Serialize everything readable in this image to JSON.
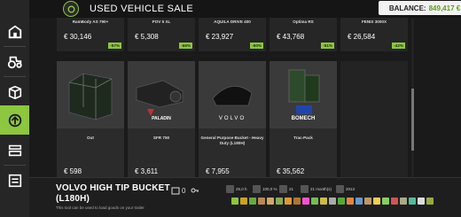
{
  "header": {
    "title": "USED VEHICLE SALE",
    "balance_label": "BALANCE:",
    "balance_value": "849,417 €"
  },
  "sidebar": {
    "items": [
      {
        "icon": "store-icon"
      },
      {
        "icon": "tractor-icon"
      },
      {
        "icon": "box-icon"
      },
      {
        "icon": "recycle-icon",
        "active": true
      },
      {
        "icon": "finance-icon"
      },
      {
        "icon": "equipment-icon"
      }
    ]
  },
  "cards_top": [
    {
      "name": "RamBody AS 790+",
      "price": "€ 30,146",
      "discount": "-57%"
    },
    {
      "name": "POV 5 XL",
      "price": "€ 5,308",
      "discount": "-66%"
    },
    {
      "name": "AQUILA DRIVE 400",
      "price": "€ 23,927",
      "discount": "-60%"
    },
    {
      "name": "Optima RS",
      "price": "€ 43,768",
      "discount": "-51%"
    },
    {
      "name": "FENIX 3000X",
      "price": "€ 26,584",
      "discount": "-42%"
    }
  ],
  "cards_row2": [
    {
      "name": "Out",
      "price": "€ 598",
      "discount": "-57%",
      "brand": ""
    },
    {
      "name": "SFR 750",
      "price": "€ 3,611",
      "discount": "-59%",
      "brand": "PALADIN"
    },
    {
      "name": "General Purpose Bucket - Heavy Duty (L180H)",
      "price": "€ 7,955",
      "discount": "-53%",
      "brand": "VOLVO"
    },
    {
      "name": "Trac-Pack",
      "price": "€ 35,562",
      "discount": "-42%",
      "brand": "BOMECH"
    }
  ],
  "selected": {
    "title": "VOLVO HIGH TIP BUCKET (L180H)",
    "description": "This tool can be used to load goods on your trailer",
    "count": "0",
    "stats": [
      "25,0 h",
      "100,0 %",
      "21",
      "21 month(s)",
      "2013"
    ]
  },
  "colors": {
    "accent": "#8dc63f",
    "background": "#1a1a1a",
    "card": "#2b2b2b"
  }
}
